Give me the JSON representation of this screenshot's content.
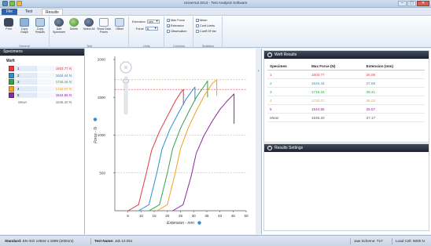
{
  "app": {
    "title": "Universal 2013 - Test Analysis Software",
    "window_controls": [
      "–",
      "▢",
      "✕"
    ]
  },
  "tabs": [
    {
      "label": "File"
    },
    {
      "label": "Test"
    },
    {
      "label": "Results"
    }
  ],
  "ribbon": {
    "general": {
      "label": "General",
      "buttons": [
        {
          "label": "Print",
          "icon": "printer-icon"
        },
        {
          "label": "Copy Graph",
          "icon": "copy-graph-icon"
        },
        {
          "label": "Copy Results",
          "icon": "copy-results-icon"
        }
      ]
    },
    "test": {
      "label": "Test",
      "buttons": [
        {
          "label": "Add Specimen",
          "icon": "add-specimen-icon"
        },
        {
          "label": "Delete",
          "icon": "delete-icon"
        },
        {
          "label": "Select All",
          "icon": "select-all-icon"
        },
        {
          "label": "Show Data Points",
          "icon": "data-points-icon"
        },
        {
          "label": "Offset",
          "icon": "offset-icon"
        }
      ]
    },
    "units": {
      "label": "Units",
      "extension_label": "Extension",
      "extension_value": "mm",
      "force_label": "Force",
      "force_value": "N"
    },
    "columns": {
      "label": "Columns",
      "items": [
        {
          "label": "Max Force",
          "checked": true
        },
        {
          "label": "Extension",
          "checked": true
        },
        {
          "label": "Observation",
          "checked": false
        }
      ]
    },
    "statistics": {
      "label": "Statistics",
      "items": [
        {
          "label": "Mean",
          "checked": true
        },
        {
          "label": "Conf Limits",
          "checked": false
        },
        {
          "label": "Coeff Of Var",
          "checked": false
        }
      ]
    }
  },
  "specimens_panel": {
    "title": "Specimens",
    "group": "Weft",
    "items": [
      {
        "name": "1",
        "value": "1603.77 N",
        "color": "#e23a46"
      },
      {
        "name": "2",
        "value": "1634.44 N",
        "color": "#2a90d0"
      },
      {
        "name": "3",
        "value": "1716.16 N",
        "color": "#33a34a"
      },
      {
        "name": "4",
        "value": "1732.07 N",
        "color": "#f2a21c"
      },
      {
        "name": "5",
        "value": "1544.55 N",
        "color": "#8a2a9c"
      }
    ],
    "mean": {
      "label": "Mean",
      "value": "1646.20 N"
    }
  },
  "chart_data": {
    "type": "line",
    "xlabel": "Extension - mm",
    "ylabel": "Force - N",
    "xlim": [
      0,
      50
    ],
    "ylim": [
      0,
      2000
    ],
    "xticks": [
      5,
      10,
      15,
      20,
      25,
      30,
      35,
      40,
      45,
      50
    ],
    "yticks": [
      500,
      1000,
      1500,
      2000
    ],
    "grid": "horizontal dashed",
    "series": [
      {
        "name": "1",
        "color": "#e23a46",
        "x": [
          5,
          9,
          12,
          14,
          17,
          20,
          23,
          25,
          26.1,
          26.1
        ],
        "y": [
          0,
          80,
          500,
          800,
          1050,
          1250,
          1450,
          1560,
          1604,
          1400
        ]
      },
      {
        "name": "2",
        "color": "#2a90d0",
        "x": [
          9,
          13,
          16,
          18,
          21,
          24,
          27,
          29.5,
          30.5,
          30.5
        ],
        "y": [
          0,
          80,
          500,
          820,
          1080,
          1280,
          1470,
          1590,
          1634,
          1450
        ]
      },
      {
        "name": "3",
        "color": "#33a34a",
        "x": [
          13,
          17,
          20,
          22,
          25,
          28,
          31,
          34,
          35.3,
          35.3
        ],
        "y": [
          0,
          80,
          500,
          820,
          1090,
          1300,
          1500,
          1650,
          1716,
          1500
        ]
      },
      {
        "name": "4",
        "color": "#f2a21c",
        "x": [
          16,
          20,
          23,
          25,
          28,
          31,
          34,
          37,
          38.8,
          38.8
        ],
        "y": [
          0,
          80,
          500,
          820,
          1100,
          1320,
          1520,
          1680,
          1732,
          1520
        ]
      },
      {
        "name": "5",
        "color": "#8a2a9c",
        "x": [
          22,
          26,
          29,
          31,
          34,
          37,
          40,
          43,
          45.4,
          45.4
        ],
        "y": [
          0,
          80,
          450,
          760,
          1000,
          1180,
          1340,
          1460,
          1545,
          1150
        ]
      }
    ],
    "reference_lines": [
      {
        "y": 1733,
        "color": "#f2a21c"
      },
      {
        "y": 1604,
        "color": "#e23a46"
      },
      {
        "y": 1000,
        "color": "#b0b0b0"
      },
      {
        "y": 500,
        "color": "#b0b0b0"
      }
    ]
  },
  "results": {
    "title": "Weft Results",
    "columns": [
      "Specimen",
      "Max Force (N)",
      "Extension (mm)"
    ],
    "rows": [
      {
        "specimen": "1",
        "max_force": "1603.77",
        "extension": "26.06",
        "color": "#e23a46"
      },
      {
        "specimen": "2",
        "max_force": "1634.44",
        "extension": "27.58",
        "color": "#2a90d0"
      },
      {
        "specimen": "3",
        "max_force": "1716.16",
        "extension": "28.41",
        "color": "#33a34a"
      },
      {
        "specimen": "4",
        "max_force": "1732.07",
        "extension": "28.23",
        "color": "#f2a21c"
      },
      {
        "specimen": "5",
        "max_force": "1544.55",
        "extension": "25.57",
        "color": "#8a2a9c"
      }
    ],
    "mean": {
      "label": "Mean",
      "max_force": "1646.20",
      "extension": "27.17"
    }
  },
  "results_settings": {
    "title": "Results Settings"
  },
  "statusbar": {
    "standard_label": "Standard:",
    "standard_value": "EN ISO 13934-1:1999 (200mm)",
    "test_name_label": "Test Name:",
    "test_name_value": "Job 12.051",
    "jaw_label": "Jaw Scheme:",
    "jaw_value": "T17",
    "load_label": "Load Cell:",
    "load_value": "5000 N"
  }
}
